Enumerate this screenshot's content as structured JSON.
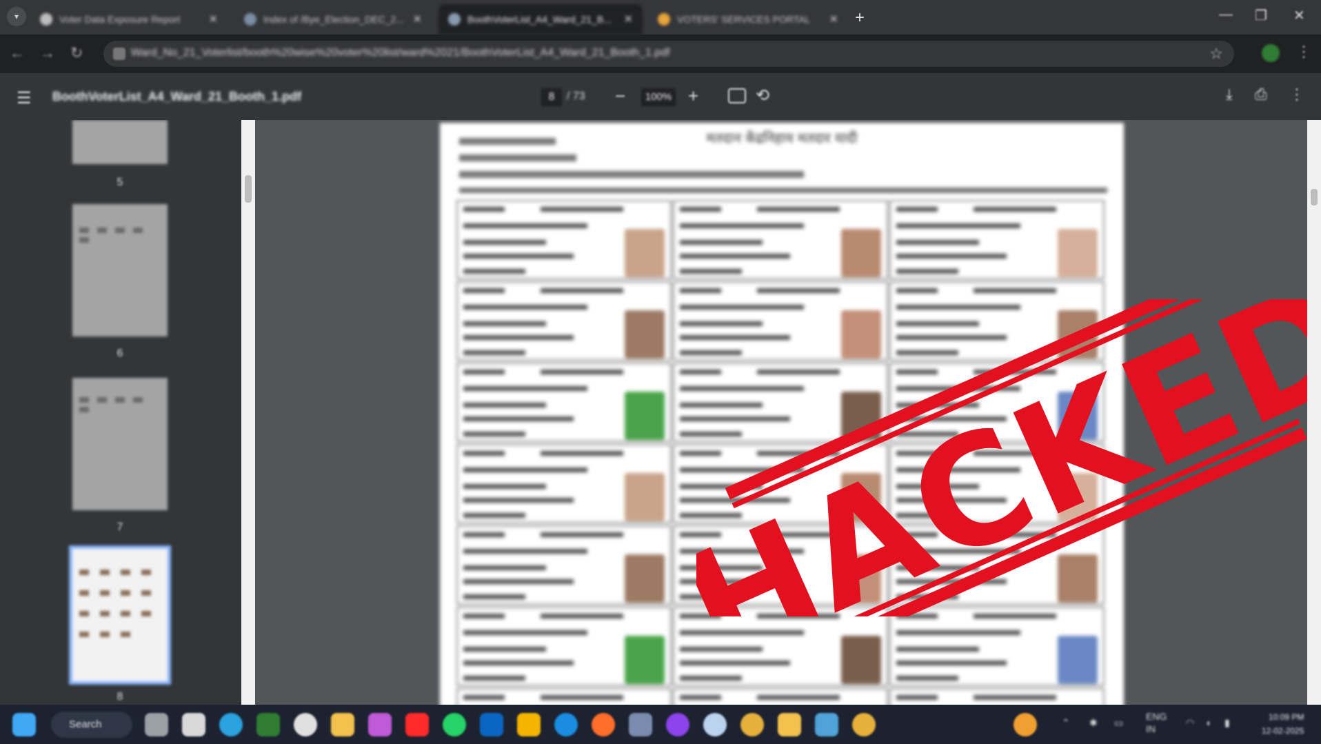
{
  "browser": {
    "tabs": [
      {
        "label": "Voter Data Exposure Report",
        "active": false
      },
      {
        "label": "Index of /Bye_Election_DEC_2...",
        "active": false
      },
      {
        "label": "BoothVoterList_A4_Ward_21_B...",
        "active": true
      },
      {
        "label": "VOTERS' SERVICES PORTAL",
        "active": false
      }
    ],
    "url": "Ward_No_21_Voterlist/booth%20wise%20voter%20list/ward%2021/BoothVoterList_A4_Ward_21_Booth_1.pdf",
    "window_controls": {
      "minimize": "—",
      "restore": "❐",
      "close": "✕"
    }
  },
  "pdf_viewer": {
    "filename": "BoothVoterList_A4_Ward_21_Booth_1.pdf",
    "current_page": "8",
    "total_pages": "/ 73",
    "zoom": "100%",
    "thumbnail_pages": [
      "5",
      "6",
      "7",
      "8"
    ],
    "selected_page": "8"
  },
  "document": {
    "title": "मतदान केंद्रनिहाय मतदार यादी"
  },
  "overlay": {
    "stamp_text": "HACKED",
    "stamp_color": "#e3101f"
  },
  "taskbar": {
    "search_label": "Search",
    "lang_top": "ENG",
    "lang_bottom": "IN",
    "time": "10:09 PM",
    "date": "12-02-2025"
  }
}
